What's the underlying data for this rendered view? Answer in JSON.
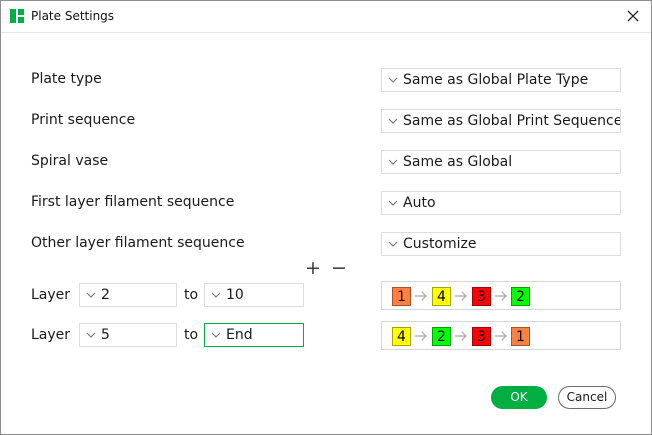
{
  "window": {
    "title": "Plate Settings"
  },
  "colors": {
    "accent": "#00ae42"
  },
  "icons": {
    "app": "bambu-studio-logo-icon",
    "close": "close-icon",
    "dropdown": "chevron-down-icon",
    "sequence_arrow": "arrow-right-icon"
  },
  "settings": [
    {
      "label": "Plate type",
      "value": "Same as Global Plate Type"
    },
    {
      "label": "Print sequence",
      "value": "Same as Global Print Sequence"
    },
    {
      "label": "Spiral vase",
      "value": "Same as Global"
    },
    {
      "label": "First layer filament sequence",
      "value": "Auto"
    },
    {
      "label": "Other layer filament sequence",
      "value": "Customize"
    }
  ],
  "layer_controls": {
    "add": "+",
    "remove": "−"
  },
  "layer_ranges": [
    {
      "label": "Layer",
      "from": "2",
      "to_label": "to",
      "to": "10",
      "sequence": [
        {
          "num": "1",
          "color": "#ff8040"
        },
        {
          "num": "4",
          "color": "#ffff00"
        },
        {
          "num": "3",
          "color": "#ff0000"
        },
        {
          "num": "2",
          "color": "#00ff00"
        }
      ]
    },
    {
      "label": "Layer",
      "from": "5",
      "to_label": "to",
      "to": "End",
      "sequence": [
        {
          "num": "4",
          "color": "#ffff00"
        },
        {
          "num": "2",
          "color": "#00ff00"
        },
        {
          "num": "3",
          "color": "#ff0000"
        },
        {
          "num": "1",
          "color": "#ff8040"
        }
      ]
    }
  ],
  "buttons": {
    "ok": "OK",
    "cancel": "Cancel"
  }
}
